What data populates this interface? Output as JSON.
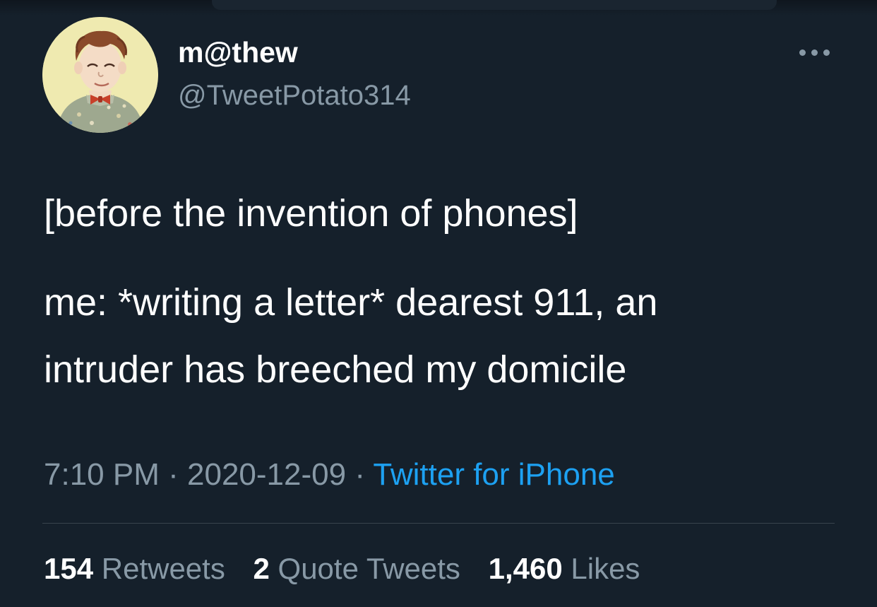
{
  "tweet": {
    "display_name": "m@thew",
    "handle": "@TweetPotato314",
    "text_lines": [
      "[before the invention of phones]",
      "me: *writing a letter* dearest 911, an",
      "intruder has breeched my domicile"
    ],
    "time": "7:10 PM",
    "separator": "·",
    "date": "2020-12-09",
    "source": "Twitter for iPhone"
  },
  "stats": {
    "retweets_count": "154",
    "retweets_label": "Retweets",
    "quote_tweets_count": "2",
    "quote_tweets_label": "Quote Tweets",
    "likes_count": "1,460",
    "likes_label": "Likes"
  },
  "icons": {
    "avatar": "cartoon-boy-bowtie-avatar",
    "more": "more-options-icon"
  },
  "colors": {
    "background": "#15202b",
    "primary_text": "#ffffff",
    "secondary_text": "#8899a6",
    "link": "#1da1f2",
    "divider": "#38444d",
    "avatar_bg": "#efeab0"
  }
}
